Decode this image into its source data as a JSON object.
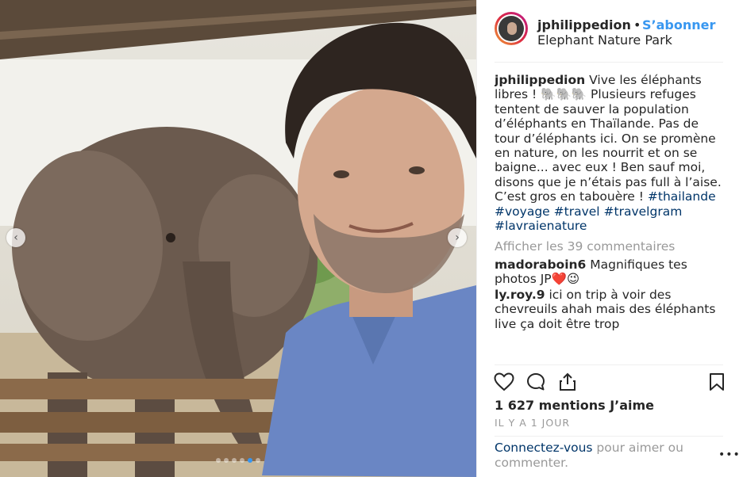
{
  "header": {
    "username": "jphilippedion",
    "separator": "•",
    "follow_label": "S’abonner",
    "location": "Elephant Nature Park",
    "avatar_ring_color": "#dc2743"
  },
  "caption": {
    "username": "jphilippedion",
    "text": "Vive les éléphants libres ! 🐘🐘🐘 Plusieurs refuges tentent de sauver la population d’éléphants en Thaïlande. Pas de tour d’éléphants ici. On se promène en nature, on les nourrit et on se baigne... avec eux ! Ben sauf moi, disons que je n’étais pas full à l’aise. C’est gros en tabouère !",
    "hashtags": [
      "#thailande",
      "#voyage",
      "#travel",
      "#travelgram",
      "#lavraienature"
    ]
  },
  "view_comments_label": "Afficher les 39 commentaires",
  "comments": [
    {
      "username": "madoraboin6",
      "text": "Magnifiques tes photos JP❤️😉"
    },
    {
      "username": "ly.roy.9",
      "text": "ici on trip à voir des chevreuils ahah mais des éléphants live ça doit être trop"
    }
  ],
  "actions": {
    "like_icon": "heart-icon",
    "comment_icon": "comment-icon",
    "share_icon": "share-icon",
    "save_icon": "bookmark-icon"
  },
  "likes_label": "1 627 mentions J’aime",
  "time_label": "IL Y A 1 JOUR",
  "login_prompt": {
    "link": "Connectez-vous",
    "text": " pour aimer ou commenter."
  },
  "more_options": "•••",
  "carousel": {
    "dot_count": 6,
    "active_index": 4,
    "active_color": "#3897f0"
  },
  "colors": {
    "link": "#003569",
    "follow": "#3897f0",
    "muted": "#999999"
  }
}
